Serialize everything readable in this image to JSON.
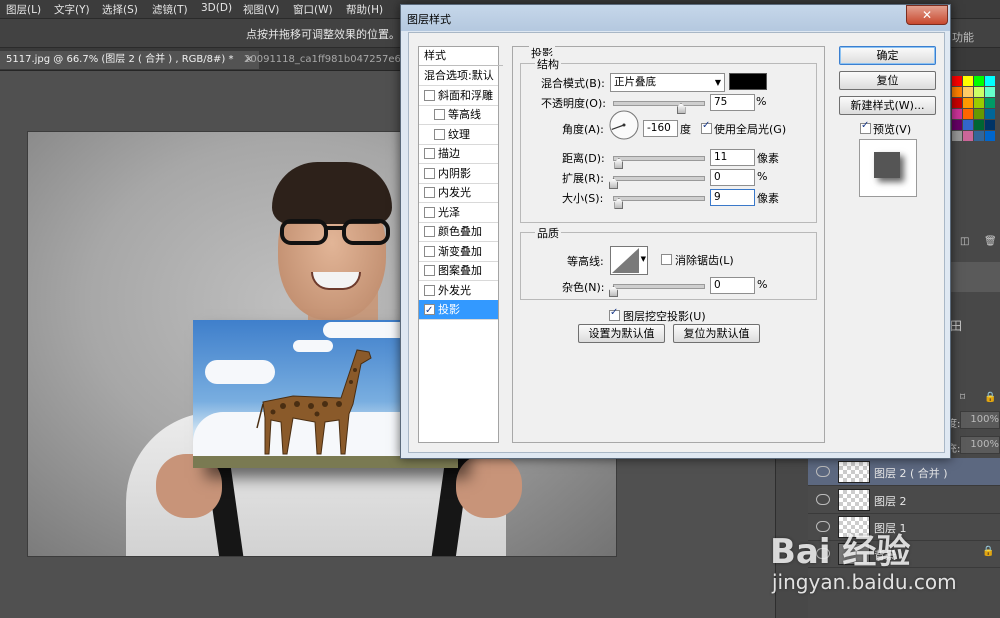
{
  "menu": [
    "图层(L)",
    "文字(Y)",
    "选择(S)",
    "滤镜(T)",
    "3D(D)",
    "视图(V)",
    "窗口(W)",
    "帮助(H)"
  ],
  "options_hint": "点按并拖移可调整效果的位置。",
  "panel_tab_fragment": "功能",
  "doc_tabs": {
    "active": "5117.jpg @ 66.7% (图层 2 ( 合并 ) , RGB/8#) *",
    "inactive": "20091118_ca1ff981b047257e66"
  },
  "dialog": {
    "title": "图层样式",
    "styles_header": "样式",
    "style_items": [
      {
        "label": "混合选项:默认",
        "checkbox": false,
        "checked": false,
        "indent": 0,
        "active": false
      },
      {
        "label": "斜面和浮雕",
        "checkbox": true,
        "checked": false,
        "indent": 0,
        "active": false
      },
      {
        "label": "等高线",
        "checkbox": true,
        "checked": false,
        "indent": 1,
        "active": false
      },
      {
        "label": "纹理",
        "checkbox": true,
        "checked": false,
        "indent": 1,
        "active": false
      },
      {
        "label": "描边",
        "checkbox": true,
        "checked": false,
        "indent": 0,
        "active": false
      },
      {
        "label": "内阴影",
        "checkbox": true,
        "checked": false,
        "indent": 0,
        "active": false
      },
      {
        "label": "内发光",
        "checkbox": true,
        "checked": false,
        "indent": 0,
        "active": false
      },
      {
        "label": "光泽",
        "checkbox": true,
        "checked": false,
        "indent": 0,
        "active": false
      },
      {
        "label": "颜色叠加",
        "checkbox": true,
        "checked": false,
        "indent": 0,
        "active": false
      },
      {
        "label": "渐变叠加",
        "checkbox": true,
        "checked": false,
        "indent": 0,
        "active": false
      },
      {
        "label": "图案叠加",
        "checkbox": true,
        "checked": false,
        "indent": 0,
        "active": false
      },
      {
        "label": "外发光",
        "checkbox": true,
        "checked": false,
        "indent": 0,
        "active": false
      },
      {
        "label": "投影",
        "checkbox": true,
        "checked": true,
        "indent": 0,
        "active": true
      }
    ],
    "section_title": "投影",
    "structure": {
      "title": "结构",
      "blend_mode_label": "混合模式(B):",
      "blend_mode_value": "正片叠底",
      "shadow_color": "#000000",
      "opacity_label": "不透明度(O):",
      "opacity_value": "75",
      "opacity_unit": "%",
      "opacity_fraction": 0.75,
      "angle_label": "角度(A):",
      "angle_value": "-160",
      "angle_unit": "度",
      "global_light_label": "使用全局光(G)",
      "global_light_checked": true,
      "distance_label": "距离(D):",
      "distance_value": "11",
      "distance_unit": "像素",
      "distance_fraction": 0.06,
      "spread_label": "扩展(R):",
      "spread_value": "0",
      "spread_unit": "%",
      "spread_fraction": 0.0,
      "size_label": "大小(S):",
      "size_value": "9",
      "size_unit": "像素",
      "size_fraction": 0.06
    },
    "quality": {
      "title": "品质",
      "contour_label": "等高线:",
      "antialias_label": "消除锯齿(L)",
      "antialias_checked": false,
      "noise_label": "杂色(N):",
      "noise_value": "0",
      "noise_unit": "%",
      "noise_fraction": 0.0
    },
    "knockout_label": "图层挖空投影(U)",
    "knockout_checked": true,
    "set_default_label": "设置为默认值",
    "reset_default_label": "复位为默认值",
    "ok_label": "确定",
    "reset_label": "复位",
    "new_style_label": "新建样式(W)...",
    "preview_label": "预览(V)",
    "preview_checked": true
  },
  "layers": [
    {
      "name": "图层 2 ( 合并 )",
      "selected": true
    },
    {
      "name": "图层 2",
      "selected": false
    },
    {
      "name": "图层 1",
      "selected": false
    },
    {
      "name": "背景",
      "selected": false
    }
  ],
  "panel_fields": {
    "opacity_pct": "100%",
    "fill_pct": "100%",
    "opacity_fragment": "度:",
    "fill_fragment": "充:"
  },
  "watermark": {
    "line1": "Bai 经验",
    "line2": "jingyan.baidu.com"
  }
}
